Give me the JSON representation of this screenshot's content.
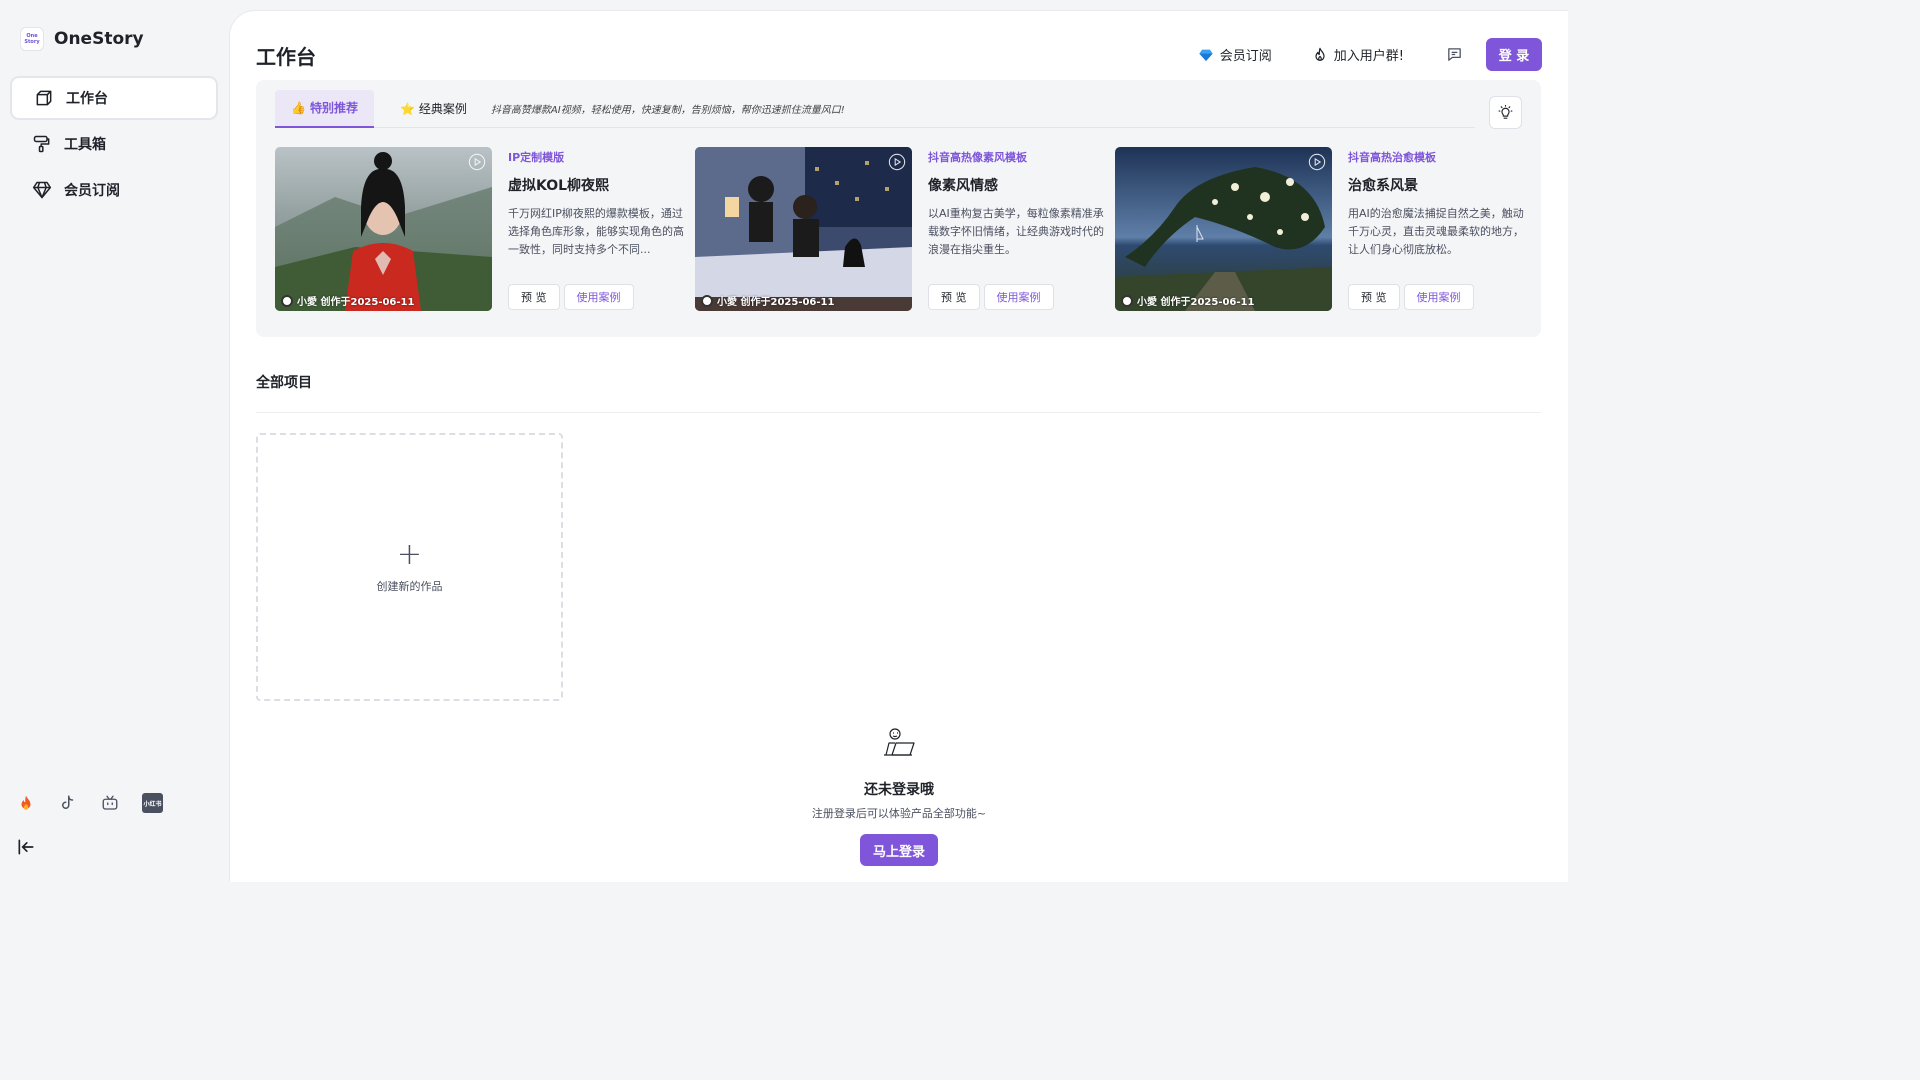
{
  "app": {
    "name": "OneStory",
    "logo_text": "One Story"
  },
  "sidebar": {
    "items": [
      {
        "label": "工作台",
        "icon": "cube-icon",
        "active": true
      },
      {
        "label": "工具箱",
        "icon": "paint-roller-icon"
      },
      {
        "label": "会员订阅",
        "icon": "diamond-icon"
      }
    ],
    "social": [
      "fire-icon",
      "tiktok-icon",
      "bilibili-icon",
      "xiaohongshu-icon"
    ],
    "xiaohongshu_text": "小红书"
  },
  "header": {
    "title": "工作台",
    "membership_label": "会员订阅",
    "join_group_label": "加入用户群!",
    "login_label": "登 录"
  },
  "featured": {
    "tabs": [
      {
        "label": "特别推荐",
        "icon": "thumbs-up-icon",
        "active": true
      },
      {
        "label": "经典案例",
        "icon": "star-icon"
      }
    ],
    "tagline": "抖音高赞爆款AI视频，轻松使用，快速复制，告别烦恼，帮你迅速抓住流量风口!",
    "cards": [
      {
        "category": "IP定制模版",
        "title": "虚拟KOL柳夜熙",
        "description": "千万网红IP柳夜熙的爆款模板，通过选择角色库形象，能够实现角色的高一致性，同时支持多个不同...",
        "author": "小愛 创作于2025-06-11",
        "preview_label": "预 览",
        "case_label": "使用案例"
      },
      {
        "category": "抖音高热像素风模板",
        "title": "像素风情感",
        "description": "以AI重构复古美学，每粒像素精准承载数字怀旧情绪，让经典游戏时代的浪漫在指尖重生。",
        "author": "小愛 创作于2025-06-11",
        "preview_label": "预 览",
        "case_label": "使用案例"
      },
      {
        "category": "抖音高热治愈模板",
        "title": "治愈系风景",
        "description": "用AI的治愈魔法捕捉自然之美，触动千万心灵，直击灵魂最柔软的地方，让人们身心彻底放松。",
        "author": "小愛 创作于2025-06-11",
        "preview_label": "预 览",
        "case_label": "使用案例"
      }
    ]
  },
  "projects": {
    "title": "全部项目",
    "create_label": "创建新的作品"
  },
  "empty_state": {
    "title": "还未登录哦",
    "subtitle": "注册登录后可以体验产品全部功能~",
    "button_label": "马上登录"
  },
  "colors": {
    "accent": "#7f56d9",
    "background": "#f4f5f7",
    "panel": "#ffffff"
  }
}
